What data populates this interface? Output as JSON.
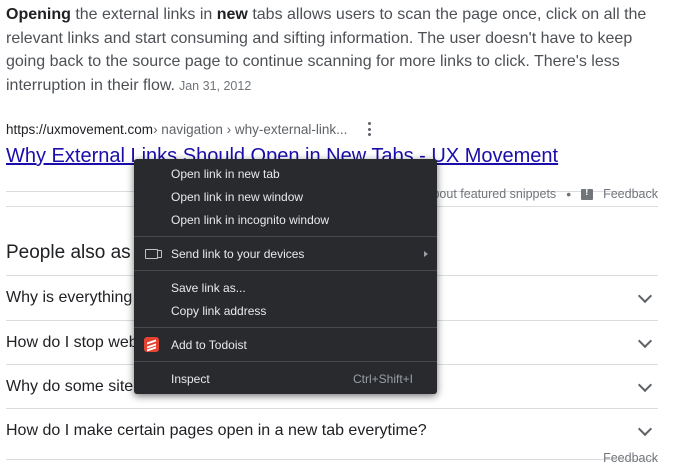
{
  "snippet": {
    "bold_start": "Opening",
    "text_1": " the external links in ",
    "bold_mid": "new",
    "text_2": " tabs allows users to scan the page once, click on all the relevant links and start consuming and sifting information. The user doesn't have to keep going back to the source page to continue scanning for more links to click. There's less interruption in their flow.",
    "date": "Jan 31, 2012"
  },
  "result": {
    "url_host": "https://uxmovement.com",
    "url_path": " › navigation › why-external-link...",
    "title": "Why External Links Should Open in New Tabs - UX Movement"
  },
  "featured": {
    "about_text": "bout featured snippets",
    "feedback": "Feedback"
  },
  "paa": {
    "title": "People also as",
    "items": [
      "Why is everything",
      "How do I stop web",
      "Why do some site",
      "How do I make certain pages open in a new tab everytime?"
    ],
    "bottom_feedback": "Feedback"
  },
  "context_menu": {
    "open_new_tab": "Open link in new tab",
    "open_new_window": "Open link in new window",
    "open_incognito": "Open link in incognito window",
    "send_to_devices": "Send link to your devices",
    "save_link_as": "Save link as...",
    "copy_link_address": "Copy link address",
    "add_to_todoist": "Add to Todoist",
    "inspect": "Inspect",
    "inspect_shortcut": "Ctrl+Shift+I"
  },
  "colors": {
    "link": "#1a0dab",
    "menu_bg": "#292a2d",
    "todoist": "#e44332"
  }
}
